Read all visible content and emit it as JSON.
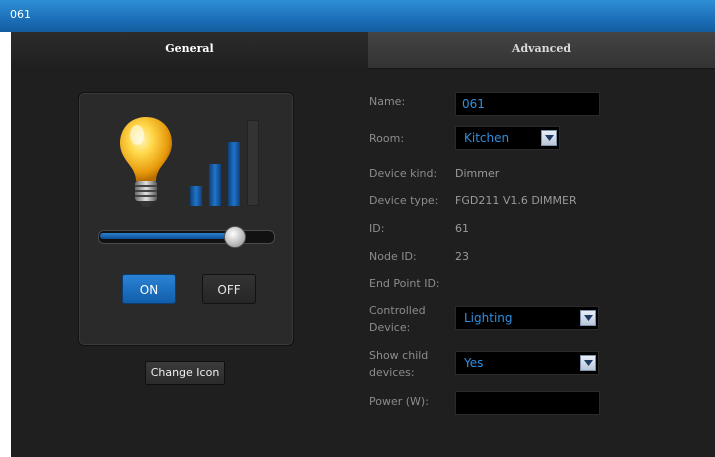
{
  "window": {
    "title": "061"
  },
  "tabs": {
    "general": "General",
    "advanced": "Advanced"
  },
  "device": {
    "brightness_percent": 78,
    "on_label": "ON",
    "off_label": "OFF",
    "change_icon_label": "Change Icon",
    "signal_bars": {
      "total": 4,
      "active": 3
    }
  },
  "form": {
    "name_label": "Name:",
    "name_value": "061",
    "room_label": "Room:",
    "room_value": "Kitchen",
    "device_kind_label": "Device kind:",
    "device_kind_value": "Dimmer",
    "device_type_label": "Device type:",
    "device_type_value": "FGD211 V1.6 DIMMER",
    "id_label": "ID:",
    "id_value": "61",
    "node_id_label": "Node ID:",
    "node_id_value": "23",
    "end_point_label": "End Point ID:",
    "controlled_label_line1": "Controlled",
    "controlled_label_line2": "Device:",
    "controlled_value": "Lighting",
    "show_child_label_line1": "Show child",
    "show_child_label_line2": "devices:",
    "show_child_value": "Yes",
    "power_label": "Power (W):",
    "power_value": ""
  },
  "icons": {
    "bulb": "light-bulb-icon",
    "dropdown": "chevron-down-icon"
  },
  "colors": {
    "accent": "#1f74c9",
    "titlebar": "#1b6fb8",
    "panel": "#1f1f1f",
    "input_text": "#2f8fe0"
  }
}
